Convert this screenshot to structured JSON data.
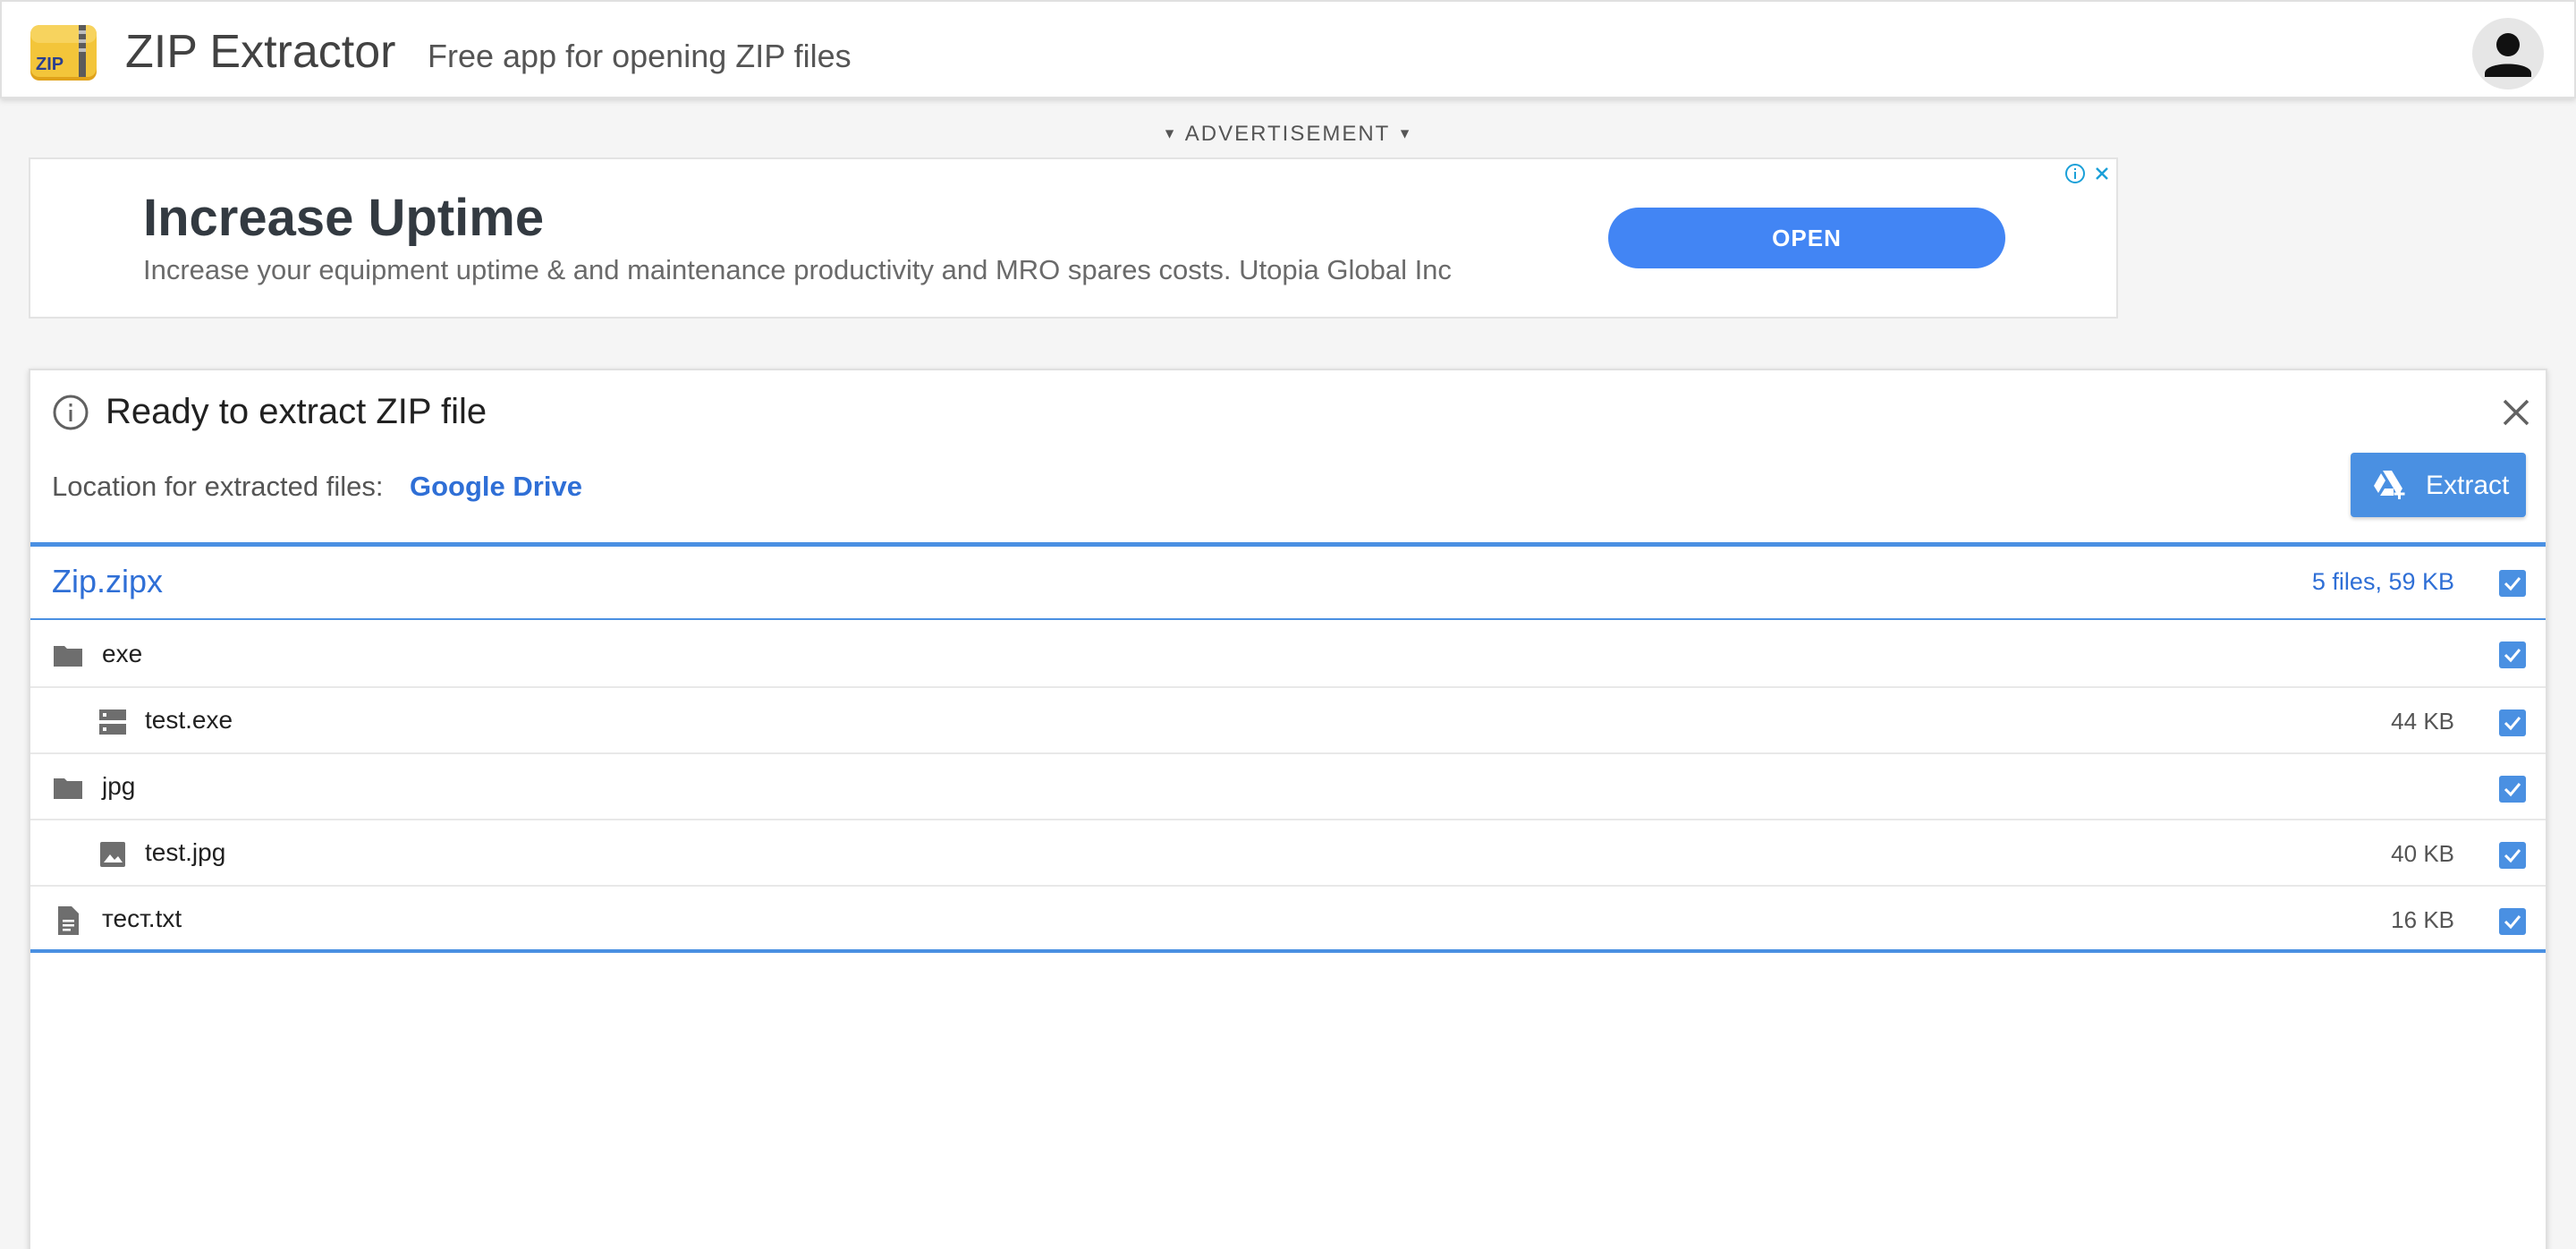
{
  "header": {
    "title": "ZIP Extractor",
    "subtitle": "Free app for opening ZIP files",
    "logo_text": "ZIP"
  },
  "ad": {
    "label": "ADVERTISEMENT",
    "title": "Increase Uptime",
    "description": "Increase your equipment uptime & and maintenance productivity and MRO spares costs. Utopia Global Inc",
    "button_label": "OPEN"
  },
  "card": {
    "title": "Ready to extract ZIP file",
    "location_label": "Location for extracted files:",
    "location_value": "Google Drive",
    "extract_label": "Extract"
  },
  "archive": {
    "name": "Zip.zipx",
    "summary": "5 files, 59 KB",
    "checked": true
  },
  "items": [
    {
      "name": "exe",
      "size": "",
      "icon": "folder-icon",
      "level": 0,
      "checked": true
    },
    {
      "name": "test.exe",
      "size": "44 KB",
      "icon": "executable-icon",
      "level": 1,
      "checked": true
    },
    {
      "name": "jpg",
      "size": "",
      "icon": "folder-icon",
      "level": 0,
      "checked": true
    },
    {
      "name": "test.jpg",
      "size": "40 KB",
      "icon": "image-icon",
      "level": 1,
      "checked": true
    },
    {
      "name": "тест.txt",
      "size": "16 KB",
      "icon": "text-file-icon",
      "level": 0,
      "checked": true
    }
  ],
  "colors": {
    "accent": "#4a90e2",
    "link": "#2f6fd6",
    "ad_button": "#4285f4",
    "icon_gray": "#6e6e6e"
  }
}
